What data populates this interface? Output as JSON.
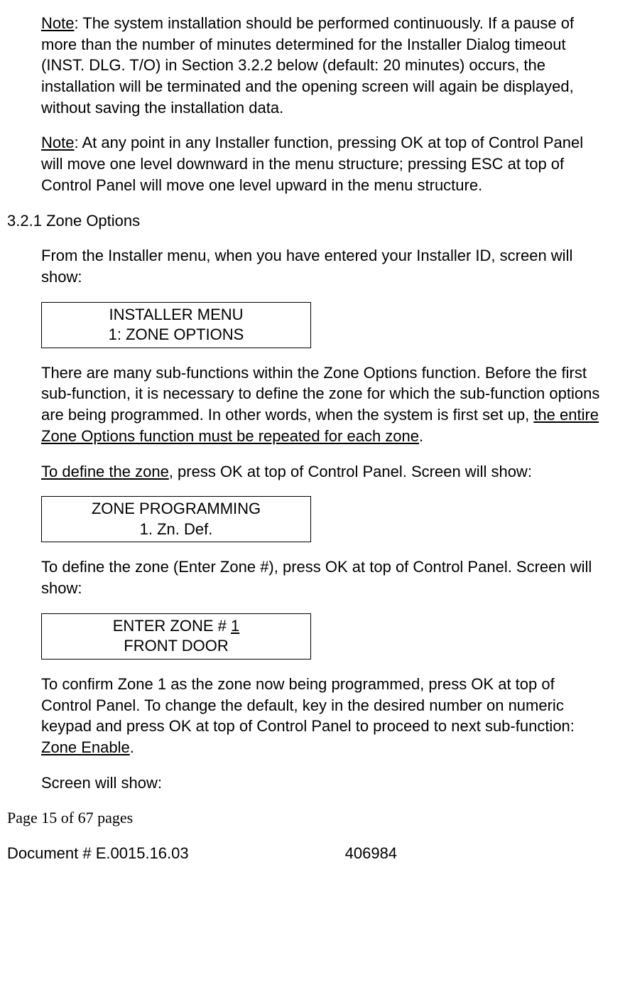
{
  "note1": {
    "label": "Note",
    "text": ": The system installation should be performed continuously. If a pause of more than the number of minutes determined for the Installer Dialog timeout (INST. DLG. T/O) in Section 3.2.2 below (default: 20 minutes) occurs, the installation will be terminated and the opening screen will again be displayed, without saving the installation data."
  },
  "note2": {
    "label": "Note",
    "text": ": At any point in any Installer function, pressing OK at top of Control Panel will move one level downward in the menu structure; pressing ESC at top of Control Panel will move one level upward in the menu structure."
  },
  "section": {
    "number": "3.2.1",
    "title": "Zone Options"
  },
  "para1": "From the Installer menu, when you have entered your Installer ID, screen will show:",
  "lcd1": {
    "line1": "INSTALLER MENU",
    "line2": "1: ZONE OPTIONS"
  },
  "para2": {
    "pre": "There are many sub-functions within the Zone Options function. Before the first sub-function, it is necessary to define the zone for which the sub-function options are being programmed. In other words, when the system is first set up, ",
    "under": "the entire Zone Options function must be repeated for each zone",
    "post": "."
  },
  "para3": {
    "under": "To define the zone",
    "post": ", press OK at top of Control Panel. Screen will show:"
  },
  "lcd2": {
    "line1": "ZONE PROGRAMMING",
    "line2": "1. Zn. Def."
  },
  "para4": "To define the zone (Enter Zone #), press OK at top of Control Panel. Screen will show:",
  "lcd3": {
    "line1_pre": "ENTER ZONE # ",
    "line1_num": "1",
    "line2": "FRONT DOOR"
  },
  "para5": {
    "pre": "To confirm Zone 1 as the zone now being programmed, press OK at top of Control Panel. To change the default, key in the desired number on numeric keypad and press OK at top of Control Panel to proceed to next sub-function: ",
    "under": "Zone Enable",
    "post": "."
  },
  "para6": "Screen will show:",
  "footer": {
    "page": "Page 15 of  67 pages",
    "docnum": "Document # E.0015.16.03",
    "rightnum": "406984"
  }
}
